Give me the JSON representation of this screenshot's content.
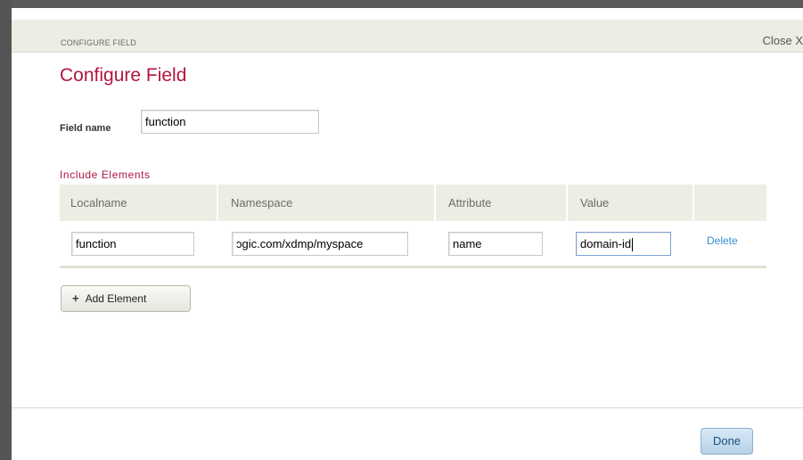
{
  "dialog": {
    "titlebar_label": "CONFIGURE FIELD",
    "close_label": "Close X",
    "heading": "Configure Field"
  },
  "field": {
    "name_label": "Field name",
    "name_value": "function"
  },
  "include_elements": {
    "title": "Include Elements",
    "columns": [
      "Localname",
      "Namespace",
      "Attribute",
      "Value"
    ],
    "rows": [
      {
        "localname": "function",
        "namespace": "ɔgic.com/xdmp/myspace",
        "attribute": "name",
        "value": "domain-id",
        "delete_label": "Delete"
      }
    ]
  },
  "buttons": {
    "add_element": "Add Element",
    "done": "Done"
  },
  "colors": {
    "accent": "#b0173f",
    "link": "#2f8ecf",
    "header_bg": "#eceee3"
  }
}
